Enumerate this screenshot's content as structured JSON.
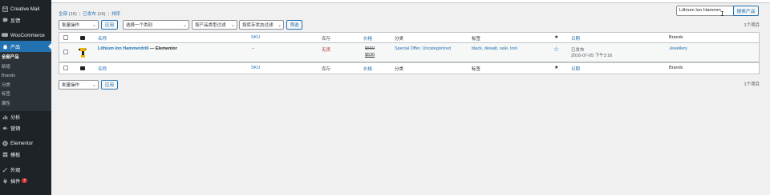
{
  "sidebar": {
    "items": [
      {
        "label": "Creative Mail",
        "icon": "creative-mail-icon"
      },
      {
        "label": "反馈",
        "icon": "feedback-icon"
      },
      {
        "label": "WooCommerce",
        "icon": "woocommerce-icon"
      },
      {
        "label": "产品",
        "icon": "products-icon",
        "active": true
      }
    ],
    "submenu": [
      "全部产品",
      "新增",
      "Brands",
      "分类",
      "标签",
      "属性"
    ],
    "items2": [
      {
        "label": "分析",
        "icon": "analytics-icon"
      },
      {
        "label": "营销",
        "icon": "marketing-icon"
      },
      {
        "label": "Elementor",
        "icon": "elementor-icon"
      },
      {
        "label": "模板",
        "icon": "templates-icon"
      },
      {
        "label": "外观",
        "icon": "appearance-icon"
      },
      {
        "label": "插件",
        "icon": "plugins-icon",
        "badge": "7"
      }
    ]
  },
  "views": {
    "all": "全部",
    "all_count": "(15)",
    "published": "已发布",
    "published_count": "(15)",
    "sort": "排序",
    "separator": "|"
  },
  "search": {
    "value": "Lithium Ion Hammm",
    "button": "搜索产品"
  },
  "top_filters": {
    "bulk": "批量操作",
    "apply": "应用",
    "category": "选择一个类别",
    "product_type": "按产品类型过滤",
    "stock_status": "按库存状态过滤",
    "filter": "筛选",
    "items_count": "1个项目"
  },
  "table": {
    "headers": {
      "name": "名称",
      "sku": "SKU",
      "stock": "库存",
      "price": "价格",
      "categories": "分类",
      "tags": "标签",
      "featured": "★",
      "date": "日期",
      "brands": "Brands"
    },
    "row": {
      "name": "Lithium Ion Hammerdrill",
      "suffix": " — Elementor",
      "sku": "–",
      "stock": "无货",
      "price_regular": "$550",
      "price_sale": "$530",
      "categories": "Special Offer, Uncategorized",
      "tags": "black, dewalt, sale, tool",
      "date_status": "已发布",
      "date_value": "2016-07-05 下午3:16",
      "brands": "Jewellery"
    }
  },
  "bottom_filters": {
    "bulk": "批量操作",
    "apply": "应用",
    "items_count": "1个项目"
  },
  "colors": {
    "admin_bar": "#1d2327",
    "accent": "#2271b1",
    "out_of_stock": "#b32d2e"
  }
}
